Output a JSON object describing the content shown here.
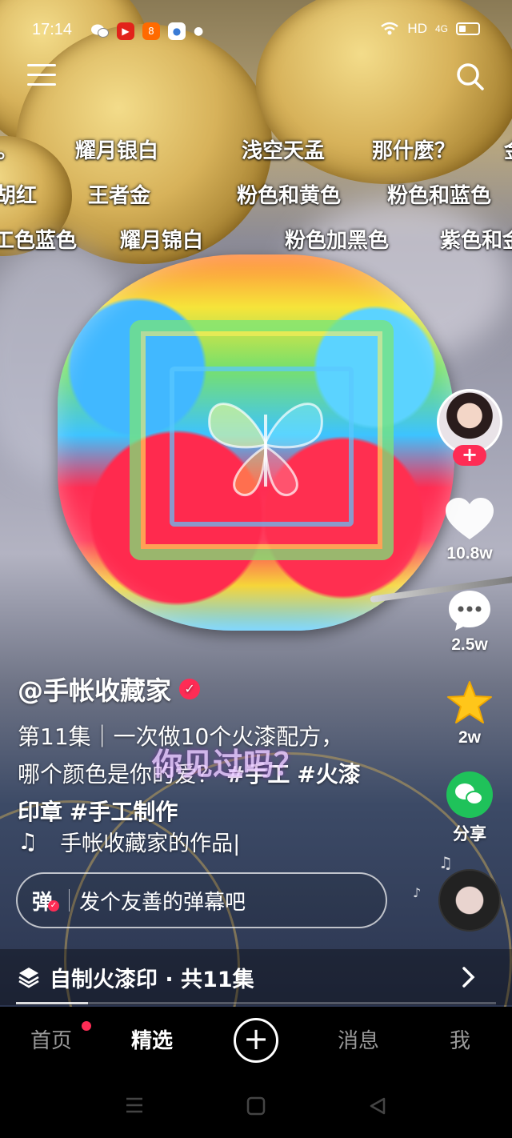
{
  "status_bar": {
    "time": "17:14",
    "network": "HD",
    "signal": "4G"
  },
  "danmaku": {
    "row1": [
      "。",
      "耀月银白",
      "浅空天孟",
      "那什麼？",
      "金"
    ],
    "row2": [
      "胡红",
      "王者金",
      "粉色和黄色",
      "粉色和蓝色"
    ],
    "row3": [
      "工色蓝色",
      "耀月锦白",
      "粉色加黑色",
      "紫色和金"
    ]
  },
  "video": {
    "overlay_caption": "你见过吗？"
  },
  "actions": {
    "follow": "+",
    "likes": "10.8w",
    "comments": "2.5w",
    "favorites": "2w",
    "share": "分享"
  },
  "post": {
    "author": "@手帐收藏家",
    "description_line1": "第11集｜一次做10个火漆配方，",
    "description_line2": "哪个颜色是你的爱？",
    "tag1": "#手工",
    "tag2": "#火漆",
    "description_line3": "印章",
    "tag3": "#手工制作",
    "music": "手帐收藏家的作品",
    "music_cursor": "|"
  },
  "comment_box": {
    "danmu_toggle": "弹",
    "placeholder": "发个友善的弹幕吧"
  },
  "playlist": {
    "title": "自制火漆印 · 共11集",
    "progress": 0.15
  },
  "bottom_nav": {
    "home": "首页",
    "featured": "精选",
    "plus": "+",
    "messages": "消息",
    "me": "我"
  }
}
